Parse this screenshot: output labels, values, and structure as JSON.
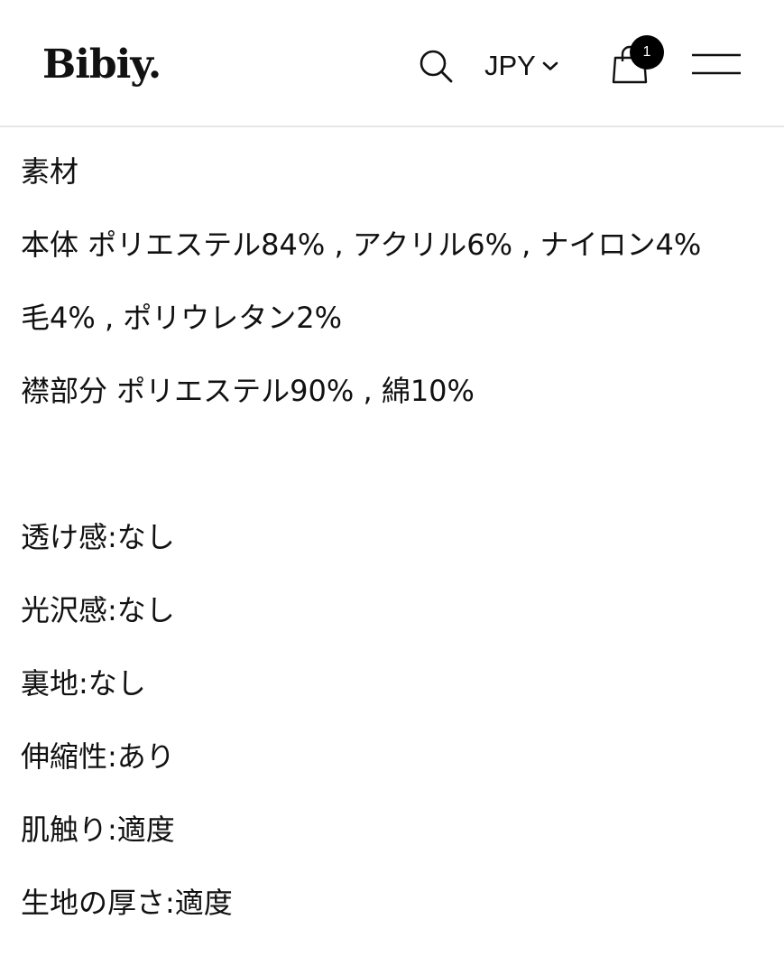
{
  "header": {
    "logo_text": "Bibiy.",
    "search_icon": "search-icon",
    "currency": {
      "label": "JPY",
      "icon": "chevron-down-icon"
    },
    "cart": {
      "icon": "shopping-bag-icon",
      "count": "1"
    },
    "menu_icon": "hamburger-menu-icon"
  },
  "description": {
    "lines": [
      "素材",
      "本体 ポリエステル84% , アクリル6% , ナイロン4%",
      "毛4% , ポリウレタン2%",
      "襟部分 ポリエステル90% , 綿10%",
      "透け感:なし",
      "光沢感:なし",
      "裏地:なし",
      "伸縮性:あり",
      "肌触り:適度",
      "生地の厚さ:適度"
    ]
  },
  "colors": {
    "text": "#111111",
    "background": "#ffffff",
    "divider": "#e6e6e6",
    "badge": "#000000"
  }
}
